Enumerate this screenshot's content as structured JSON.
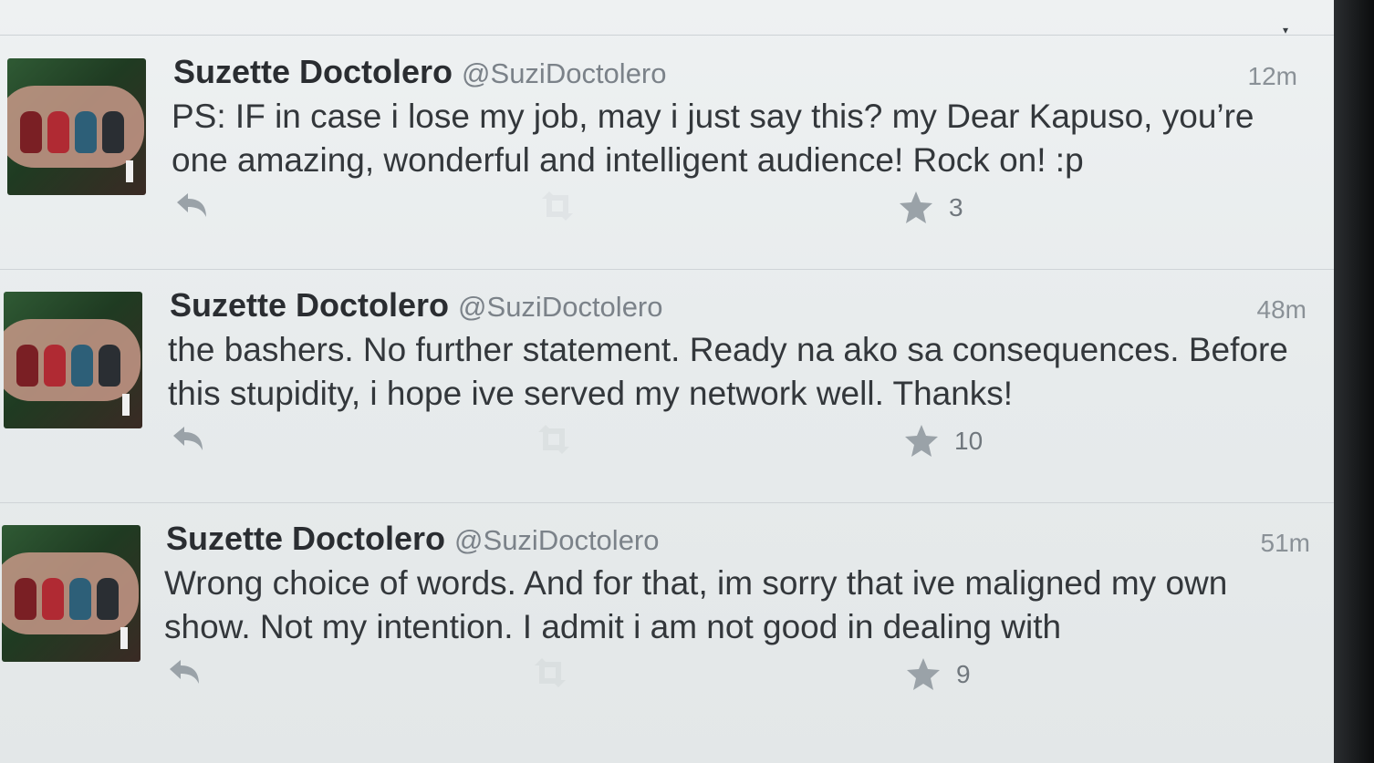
{
  "timeline": {
    "tweets": [
      {
        "name": "Suzette Doctolero",
        "handle": "@SuziDoctolero",
        "time": "12m",
        "text": "PS: IF in case i lose my job, may i just say this?  my Dear Kapuso, you’re one amazing, wonderful and intelligent audience!  Rock on! :p",
        "favorites": "3"
      },
      {
        "name": "Suzette Doctolero",
        "handle": "@SuziDoctolero",
        "time": "48m",
        "text": "the bashers.  No further statement.  Ready na ako sa consequences. Before this stupidity, i hope ive served my network well.  Thanks!",
        "favorites": "10"
      },
      {
        "name": "Suzette Doctolero",
        "handle": "@SuziDoctolero",
        "time": "51m",
        "text": "Wrong choice of words.   And for that, im sorry that ive maligned my own show.    Not my intention.  I admit i am not good in dealing with",
        "favorites": "9"
      }
    ]
  },
  "icons": {
    "reply": "reply-icon",
    "retweet": "retweet-icon",
    "favorite": "star-icon",
    "more": "chevron-down-icon"
  },
  "colors": {
    "text": "#33373b",
    "muted": "#7b8289",
    "icon": "#9aa2a8"
  }
}
